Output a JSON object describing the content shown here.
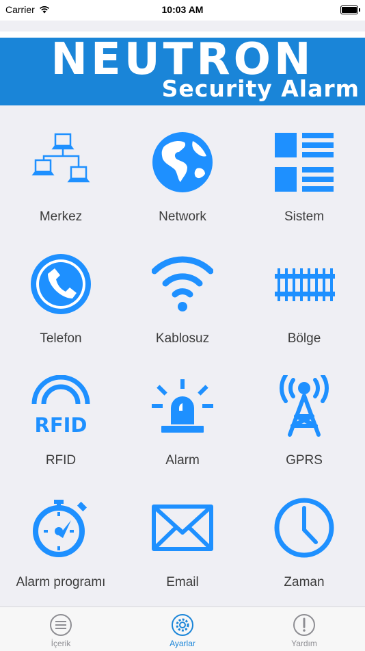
{
  "status": {
    "carrier": "Carrier",
    "time": "10:03 AM",
    "battery_level": 1.0
  },
  "banner": {
    "title": "NEUTRON",
    "subtitle": "Security Alarm"
  },
  "colors": {
    "accent": "#1a85d8",
    "icon": "#1e90ff",
    "tab_inactive": "#8e8e93"
  },
  "grid": {
    "items": [
      {
        "label": "Merkez",
        "icon": "network-computers-icon"
      },
      {
        "label": "Network",
        "icon": "globe-icon"
      },
      {
        "label": "Sistem",
        "icon": "list-blocks-icon"
      },
      {
        "label": "Telefon",
        "icon": "phone-icon"
      },
      {
        "label": "Kablosuz",
        "icon": "wifi-icon"
      },
      {
        "label": "Bölge",
        "icon": "zone-rail-icon"
      },
      {
        "label": "RFID",
        "icon": "rfid-icon"
      },
      {
        "label": "Alarm",
        "icon": "siren-icon"
      },
      {
        "label": "GPRS",
        "icon": "antenna-tower-icon"
      },
      {
        "label": "Alarm programı",
        "icon": "stopwatch-icon"
      },
      {
        "label": "Email",
        "icon": "envelope-icon"
      },
      {
        "label": "Zaman",
        "icon": "clock-icon"
      }
    ]
  },
  "tabs": [
    {
      "label": "İçerik",
      "icon": "menu-lines-icon",
      "active": false
    },
    {
      "label": "Ayarlar",
      "icon": "gear-icon",
      "active": true
    },
    {
      "label": "Yardım",
      "icon": "exclamation-icon",
      "active": false
    }
  ]
}
